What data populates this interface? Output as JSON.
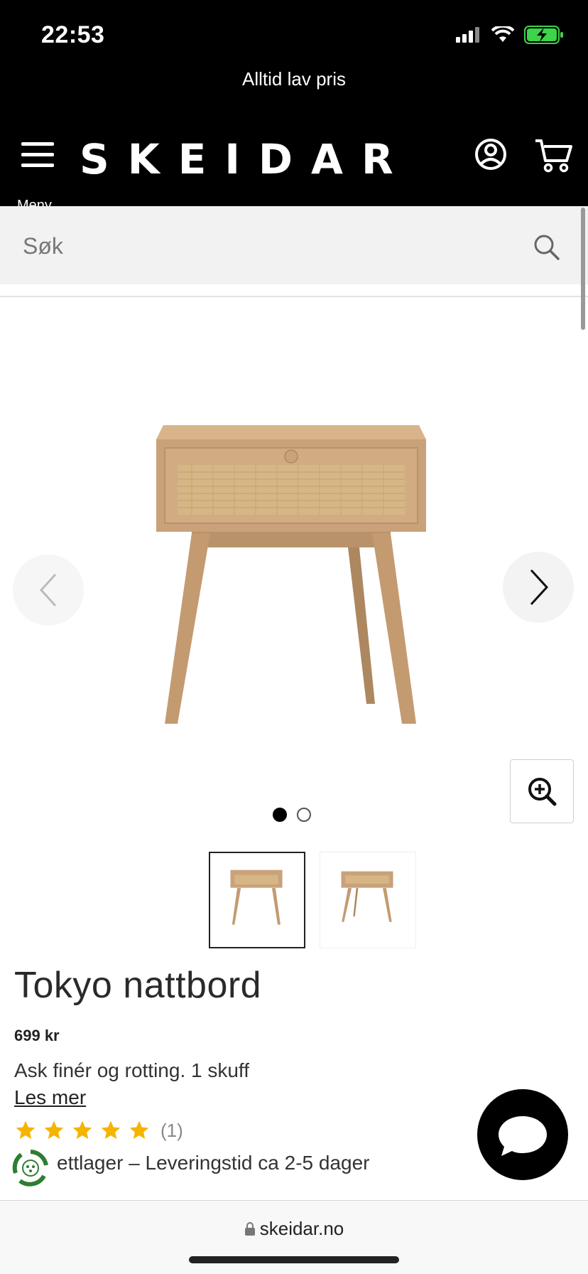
{
  "status_bar": {
    "time": "22:53"
  },
  "promo": {
    "text": "Alltid lav pris"
  },
  "header": {
    "menu_label": "Meny",
    "logo": "SKEIDAR"
  },
  "search": {
    "placeholder": "Søk"
  },
  "gallery": {
    "active_index": 0,
    "image_count": 2
  },
  "product": {
    "title": "Tokyo nattbord",
    "price": "699 kr",
    "description": "Ask finér og rotting. 1 skuff",
    "read_more": "Les mer",
    "rating_stars": 5,
    "rating_count": "(1)",
    "stock": "ettlager – Leveringstid ca 2-5 dager"
  },
  "browser": {
    "url": "skeidar.no"
  },
  "colors": {
    "header_bg": "#000000",
    "star": "#f5b400",
    "eco": "#2e7d32"
  }
}
